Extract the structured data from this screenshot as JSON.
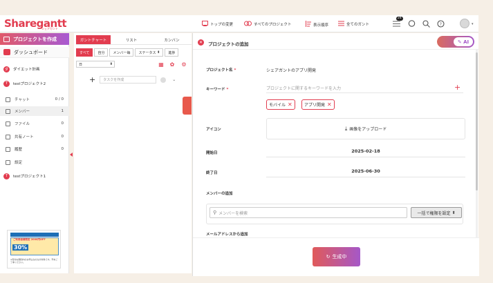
{
  "header": {
    "logo": "Sharegantt",
    "logo_sub": "シェアガント",
    "nav": [
      {
        "icon": "monitor-icon",
        "label": "トップの変更"
      },
      {
        "icon": "projects-icon",
        "label": "すべてのプロジェクト"
      },
      {
        "icon": "sort-icon",
        "label": "表示順序"
      },
      {
        "icon": "list-icon",
        "label": "全てのガント"
      }
    ],
    "badge_count": "24"
  },
  "sidebar": {
    "create_label": "プロジェクトを作成",
    "dashboard_label": "ダッシュボード",
    "projects": [
      {
        "initial": "ダ",
        "label": "ダイエット計画"
      },
      {
        "initial": "T",
        "label": "testプロジェクト2"
      }
    ],
    "sub_items": [
      {
        "icon": "chat-icon",
        "label": "チャット",
        "count": "0 / 0"
      },
      {
        "icon": "members-icon",
        "label": "メンバー",
        "count": "1"
      },
      {
        "icon": "file-icon",
        "label": "ファイル",
        "count": "0"
      },
      {
        "icon": "note-icon",
        "label": "共有ノート",
        "count": "0"
      },
      {
        "icon": "history-icon",
        "label": "履歴",
        "count": "0"
      },
      {
        "icon": "settings-icon",
        "label": "設定",
        "count": ""
      }
    ],
    "project3": {
      "initial": "T",
      "label": "testプロジェクト1"
    },
    "promo": {
      "headline": "ご利用者様限定 2000円OFF",
      "big": "30%",
      "text": "※有効な期間内のお申込みのみが対象です。予めご了承ください。"
    }
  },
  "gantt": {
    "tabs": [
      "ガントチャート",
      "リスト",
      "カンバン"
    ],
    "filters": [
      "すべて",
      "自分",
      "メンバー毎",
      "ステータス",
      "進捗"
    ],
    "day_select": "日",
    "task_placeholder": "タスクを作成"
  },
  "panel": {
    "title": "プロジェクトの追加",
    "ai_label": "AI",
    "project_name_label": "プロジェクト名",
    "project_name_value": "シェアガントのアプリ開発",
    "keyword_label": "キーワード",
    "keyword_placeholder": "プロジェクトに関するキーワードを入力",
    "tags": [
      "モバイル",
      "アプリ開発"
    ],
    "icon_label": "アイコン",
    "upload_label": "画像をアップロード",
    "start_label": "開始日",
    "start_value": "2025-02-18",
    "end_label": "終了日",
    "end_value": "2025-06-30",
    "members_label": "メンバーの追加",
    "member_search_placeholder": "メンバーを検索",
    "perm_button": "一括で権限を設定",
    "email_label": "メールアドレスから追加",
    "generate_label": "生成中"
  }
}
